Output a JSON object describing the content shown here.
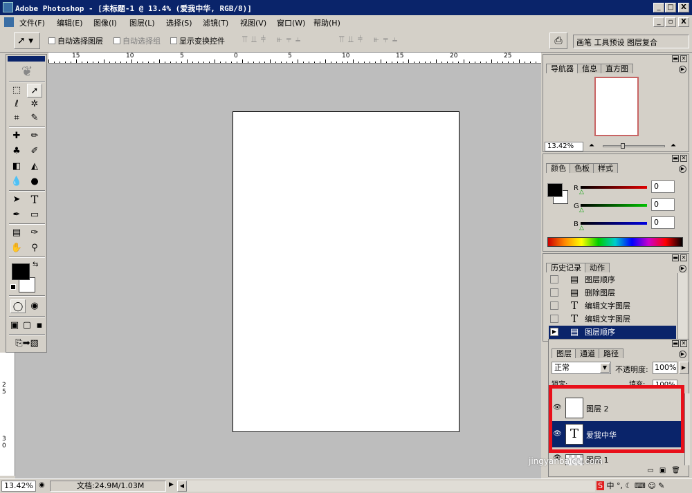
{
  "window": {
    "title": "Adobe Photoshop - [未标题-1 @ 13.4% (爱我中华, RGB/8)]",
    "minimize": "_",
    "restore": "□",
    "close": "X"
  },
  "menu": [
    "文件(F)",
    "编辑(E)",
    "图像(I)",
    "图层(L)",
    "选择(S)",
    "滤镜(T)",
    "视图(V)",
    "窗口(W)",
    "帮助(H)"
  ],
  "options": {
    "auto_select_layer": "自动选择图层",
    "auto_select_group": "自动选择组",
    "show_transform": "显示变换控件",
    "palette_well": "画笔 工具预设 图层复合"
  },
  "ruler_h": [
    "15",
    "10",
    "5",
    "0",
    "5",
    "10",
    "15",
    "20",
    "25"
  ],
  "ruler_v": [
    "2",
    "5",
    "3",
    "0"
  ],
  "navigator": {
    "tabs": [
      "导航器",
      "信息",
      "直方图"
    ],
    "zoom": "13.42%"
  },
  "color": {
    "tabs": [
      "颜色",
      "色板",
      "样式"
    ],
    "channels": [
      {
        "label": "R",
        "value": "0",
        "color": "#e00000"
      },
      {
        "label": "G",
        "value": "0",
        "color": "#00c000"
      },
      {
        "label": "B",
        "value": "0",
        "color": "#0000e0"
      }
    ]
  },
  "history": {
    "tabs": [
      "历史记录",
      "动作"
    ],
    "items": [
      {
        "label": "图层顺序",
        "icon": "▤"
      },
      {
        "label": "删除图层",
        "icon": "▤"
      },
      {
        "label": "编辑文字图层",
        "icon": "T"
      },
      {
        "label": "编辑文字图层",
        "icon": "T"
      },
      {
        "label": "图层顺序",
        "icon": "▤"
      }
    ]
  },
  "layers": {
    "tabs": [
      "图层",
      "通道",
      "路径"
    ],
    "blend_mode": "正常",
    "opacity_label": "不透明度:",
    "opacity": "100%",
    "lock_label": "锁定:",
    "fill_label": "填充:",
    "fill": "100%",
    "rows": [
      {
        "name": "图层 2",
        "thumb": ""
      },
      {
        "name": "爱我中华",
        "thumb": "T"
      },
      {
        "name": "图层 1",
        "thumb": ""
      }
    ]
  },
  "status": {
    "zoom": "13.42%",
    "doc": "文档:24.9M/1.03M"
  },
  "watermark": "jingyanbaidu.com"
}
